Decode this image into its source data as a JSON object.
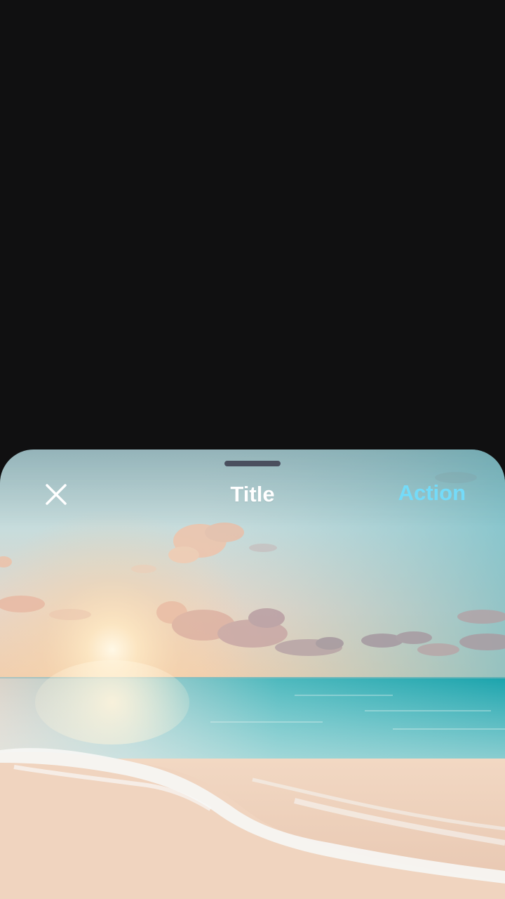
{
  "sheet": {
    "title": "Title",
    "action_label": "Action",
    "close_icon": "close-icon",
    "background_image": "beach-sunset-photo"
  },
  "colors": {
    "backdrop": "#101011",
    "action": "#74dbf9",
    "title": "#ffffff",
    "handle": "#4a4f5e"
  }
}
